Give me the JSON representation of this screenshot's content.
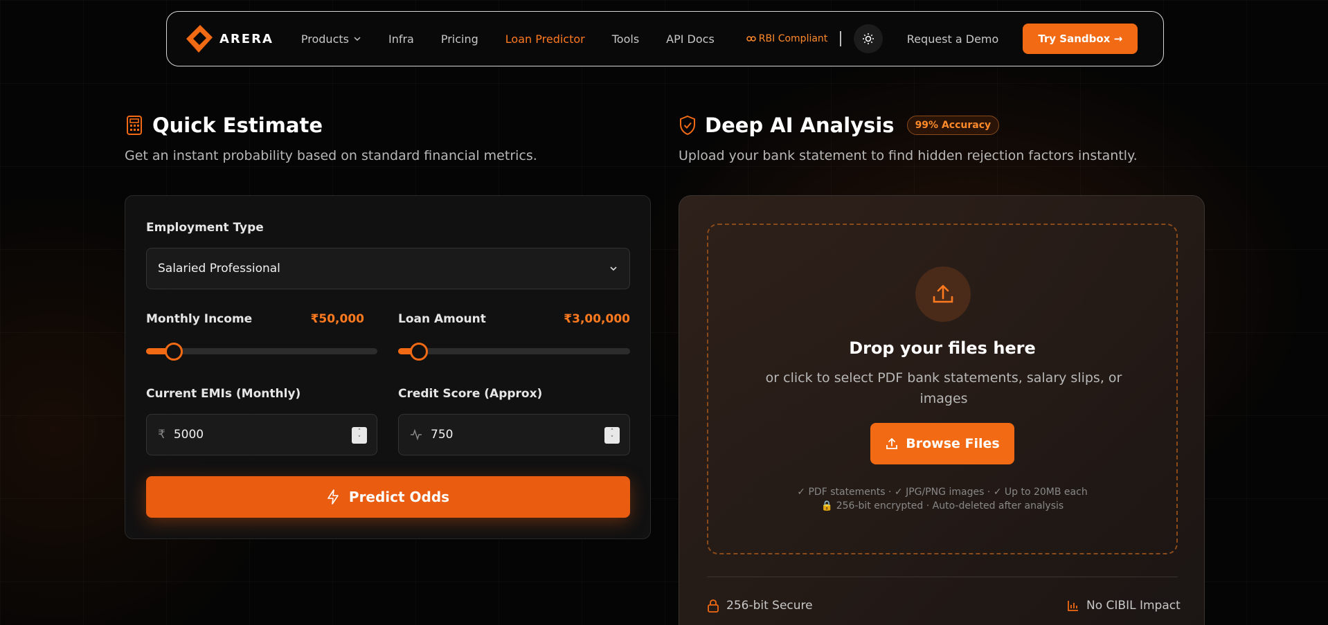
{
  "nav": {
    "brand": "ARERA",
    "links": [
      {
        "label": "Products",
        "has_dropdown": true
      },
      {
        "label": "Infra"
      },
      {
        "label": "Pricing"
      },
      {
        "label": "Loan Predictor",
        "active": true
      },
      {
        "label": "Tools"
      },
      {
        "label": "API Docs"
      }
    ],
    "rbi_label": "RBI Compliant",
    "demo_label": "Request a Demo",
    "sandbox_label": "Try Sandbox →"
  },
  "quick": {
    "title": "Quick Estimate",
    "subtitle": "Get an instant probability based on standard financial metrics.",
    "employment_label": "Employment Type",
    "employment_value": "Salaried Professional",
    "income_label": "Monthly Income",
    "income_value": "₹50,000",
    "income_level": 0.12,
    "loan_label": "Loan Amount",
    "loan_value": "₹3,00,000",
    "loan_level": 0.09,
    "emi_label": "Current EMIs (Monthly)",
    "emi_value": "5000",
    "credit_label": "Credit Score (Approx)",
    "credit_value": "750",
    "predict_label": "Predict Odds"
  },
  "deep": {
    "title": "Deep AI Analysis",
    "badge": "99% Accuracy",
    "subtitle": "Upload your bank statement to find hidden rejection factors instantly.",
    "drop_title": "Drop your files here",
    "drop_sub": "or click to select PDF bank statements, salary slips, or images",
    "browse_label": "Browse Files",
    "note1": "✓ PDF statements · ✓ JPG/PNG images · ✓ Up to 20MB each",
    "note2": "256-bit encrypted · Auto-deleted after analysis",
    "footer_secure": "256-bit Secure",
    "footer_cibil": "No CIBIL Impact"
  },
  "colors": {
    "accent": "#f26a14",
    "accent_text": "#ff7a1f"
  }
}
